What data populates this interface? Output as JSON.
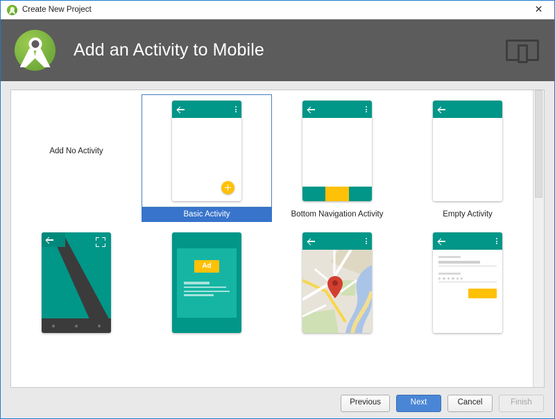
{
  "window": {
    "title": "Create New Project",
    "title_icon": "android-studio-icon",
    "close_label": "✕"
  },
  "header": {
    "title": "Add an Activity to Mobile",
    "logo_icon": "android-studio-logo",
    "device_icon": "tablet-and-phone-icon"
  },
  "templates": [
    {
      "id": "add-no-activity",
      "label": "Add No Activity",
      "kind": "text",
      "selected": false
    },
    {
      "id": "basic-activity",
      "label": "Basic Activity",
      "kind": "phone",
      "selected": true,
      "appbar": {
        "back": true,
        "overflow": true
      },
      "fab": true
    },
    {
      "id": "bottom-navigation-activity",
      "label": "Bottom Navigation Activity",
      "kind": "phone",
      "selected": false,
      "appbar": {
        "back": true,
        "overflow": true
      },
      "bottom_nav": {
        "segments": 3,
        "active_index": 1
      }
    },
    {
      "id": "empty-activity",
      "label": "Empty Activity",
      "kind": "phone",
      "selected": false,
      "appbar": {
        "back": true,
        "overflow": false
      }
    },
    {
      "id": "fullscreen-activity",
      "label": "",
      "kind": "fullscreen",
      "selected": false,
      "expand_icon": "fullscreen-expand-icon",
      "nav_dots": 3
    },
    {
      "id": "google-admob-ads-activity",
      "label": "",
      "kind": "admob",
      "selected": false,
      "badge_text": "Ad"
    },
    {
      "id": "google-maps-activity",
      "label": "",
      "kind": "maps",
      "selected": false,
      "appbar": {
        "back": true,
        "overflow": true
      },
      "marker_icon": "map-pin-icon"
    },
    {
      "id": "login-activity",
      "label": "",
      "kind": "login",
      "selected": false,
      "appbar": {
        "back": true,
        "overflow": true
      },
      "password_dots": 6
    }
  ],
  "footer": {
    "previous": "Previous",
    "next": "Next",
    "cancel": "Cancel",
    "finish": "Finish"
  },
  "colors": {
    "accent_blue": "#3874cb",
    "button_blue": "#4a86d6",
    "teal": "#009688",
    "amber": "#ffc107",
    "header_gray": "#5c5c5c",
    "android_green": "#7cb342",
    "map_pin_red": "#d23f31"
  }
}
